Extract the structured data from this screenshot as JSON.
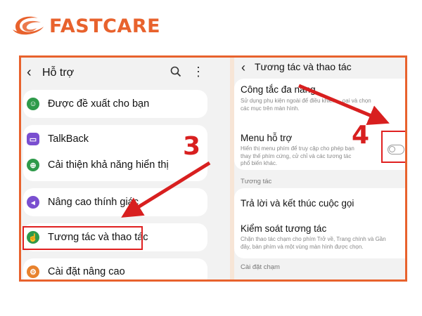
{
  "brand": {
    "name": "FASTCARE",
    "color": "#e8622d"
  },
  "left_panel": {
    "title": "Hỗ trợ",
    "items": [
      {
        "label": "Được đề xuất cho bạn",
        "icon": "accessibility-icon",
        "color": "#2e9a4a"
      },
      {
        "label": "TalkBack",
        "icon": "talkback-icon",
        "color": "#7a4fd0"
      },
      {
        "label": "Cải thiện khả năng hiển thị",
        "icon": "visibility-icon",
        "color": "#2e9a4a"
      },
      {
        "label": "Nâng cao thính giác",
        "icon": "hearing-icon",
        "color": "#7a4fd0"
      },
      {
        "label": "Tương tác và thao tác",
        "icon": "interaction-icon",
        "color": "#2e9a4a"
      },
      {
        "label": "Cài đặt nâng cao",
        "icon": "advanced-settings-icon",
        "color": "#e8822d"
      }
    ]
  },
  "right_panel": {
    "title": "Tương tác và thao tác",
    "universal_switch": {
      "title": "Công tắc đa năng",
      "desc_line1": "Sử dụng phụ kiện ngoài để điều khiển",
      "desc_line1_end": "oại và chọn",
      "desc_line2": "các mục trên màn hình."
    },
    "assistant_menu": {
      "title": "Menu hỗ trợ",
      "desc_line1": "Hiển thị menu phím để truy cập cho phép bạn",
      "desc_line2": "thay thế phím cứng, cử chỉ và các tương tác",
      "desc_line3": "phổ biến khác.",
      "enabled": false
    },
    "section_interaction": "Tương tác",
    "answer_end_calls": "Trả lời và kết thúc cuộc gọi",
    "interaction_control": {
      "title": "Kiểm soát tương tác",
      "desc_line1": "Chặn thao tác chạm cho phím Trở về, Trang chính và Gần",
      "desc_line2": "đây, bàn phím và một vùng màn hình được chọn."
    },
    "section_touch": "Cài đặt chạm"
  },
  "annotations": {
    "step3": "3",
    "step4": "4",
    "arrow_color": "#d81f1f"
  }
}
